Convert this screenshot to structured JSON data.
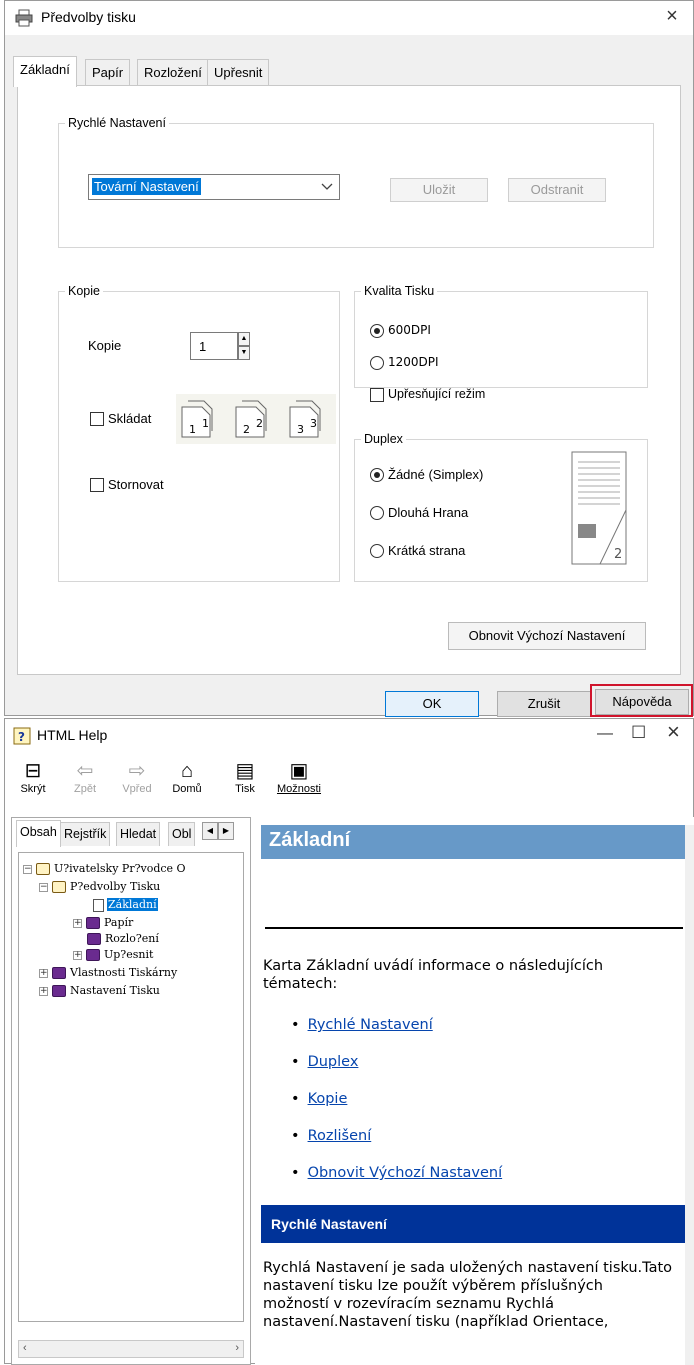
{
  "dialog": {
    "title": "Předvolby tisku",
    "close": "×",
    "tabs": [
      "Základní",
      "Papír",
      "Rozložení",
      "Upřesnit"
    ],
    "quick": {
      "legend": "Rychlé Nastavení",
      "selected": "Tovární Nastavení",
      "save": "Uložit",
      "remove": "Odstranit"
    },
    "copies": {
      "legend": "Kopie",
      "label": "Kopie",
      "value": "1",
      "collate": "Skládat",
      "reverse": "Stornovat",
      "collate_pages": [
        [
          "1",
          "1"
        ],
        [
          "2",
          "2"
        ],
        [
          "3",
          "3"
        ]
      ]
    },
    "quality": {
      "legend": "Kvalita Tisku",
      "opt1": "600DPI",
      "opt2": "1200DPI",
      "refine": "Upřesňující režim"
    },
    "duplex": {
      "legend": "Duplex",
      "opt1": "Žádné (Simplex)",
      "opt2": "Dlouhá Hrana",
      "opt3": "Krátká strana",
      "preview_page": "2"
    },
    "restore": "Obnovit Výchozí Nastavení",
    "ok": "OK",
    "cancel": "Zrušit",
    "help": "Nápověda",
    "colors": {
      "highlight": "#d0142c"
    }
  },
  "help": {
    "title": "HTML Help",
    "min": "—",
    "max": "☐",
    "close": "×",
    "toolbar": {
      "hide": "Skrýt",
      "back": "Zpět",
      "forward": "Vpřed",
      "home": "Domů",
      "print": "Tisk",
      "options": "Možnosti"
    },
    "nav_tabs": [
      "Obsah",
      "Rejstřík",
      "Hledat",
      "Obl"
    ],
    "tree": {
      "root": "U?ivatelsky Pr?vodce O",
      "prefs": "P?edvolby Tisku",
      "basic": "Základní",
      "paper": "Papír",
      "layout": "Rozlo?ení",
      "advanced": "Up?esnit",
      "props": "Vlastnosti Tiskárny",
      "settings": "Nastavení Tisku"
    },
    "topic": {
      "heading": "Základní",
      "intro": "Karta Základní uvádí informace o následujících tématech:",
      "links": [
        "Rychlé Nastavení",
        "Duplex",
        "Kopie",
        "Rozlišení",
        "Obnovit Výchozí Nastavení"
      ],
      "section": "Rychlé Nastavení",
      "section_text": "Rychlá Nastavení je sada uložených nastavení tisku.Tato nastavení tisku lze použít výběrem příslušných možností v rozevíracím seznamu Rychlá nastavení.Nastavení tisku (například Orientace,"
    }
  }
}
